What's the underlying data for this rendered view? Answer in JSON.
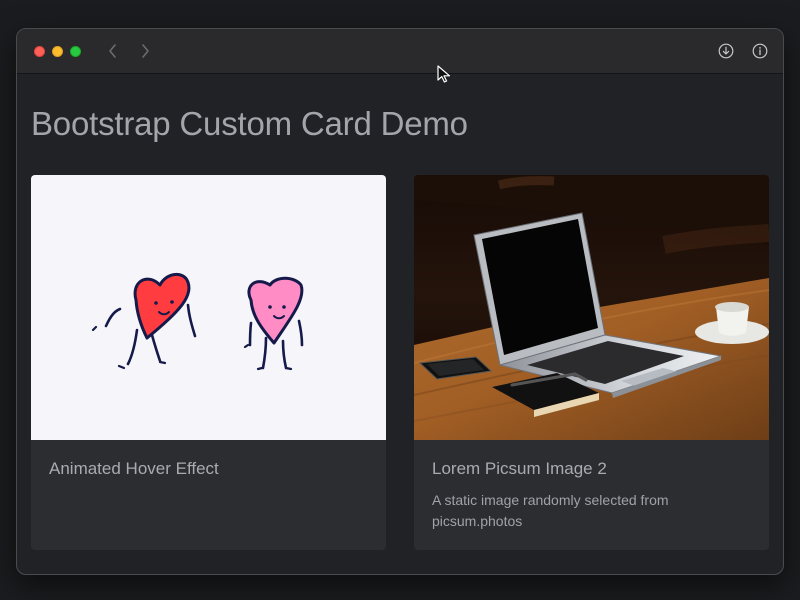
{
  "page": {
    "title": "Bootstrap Custom Card Demo"
  },
  "toolbar": {
    "back_icon": "chevron-left-icon",
    "forward_icon": "chevron-right-icon",
    "download_icon": "download-icon",
    "info_icon": "info-icon"
  },
  "cards": [
    {
      "title": "Animated Hover Effect",
      "text": "",
      "image": "two-dancing-cartoon-hearts"
    },
    {
      "title": "Lorem Picsum Image 2",
      "text": "A static image randomly selected from picsum.photos",
      "image": "laptop-on-wooden-table"
    }
  ],
  "colors": {
    "window_background": "#212226",
    "card_background": "#2b2d31",
    "title_text": "#a3a5aa",
    "close": "#fe5f57",
    "minimize": "#febc2e",
    "maximize": "#28c840"
  }
}
